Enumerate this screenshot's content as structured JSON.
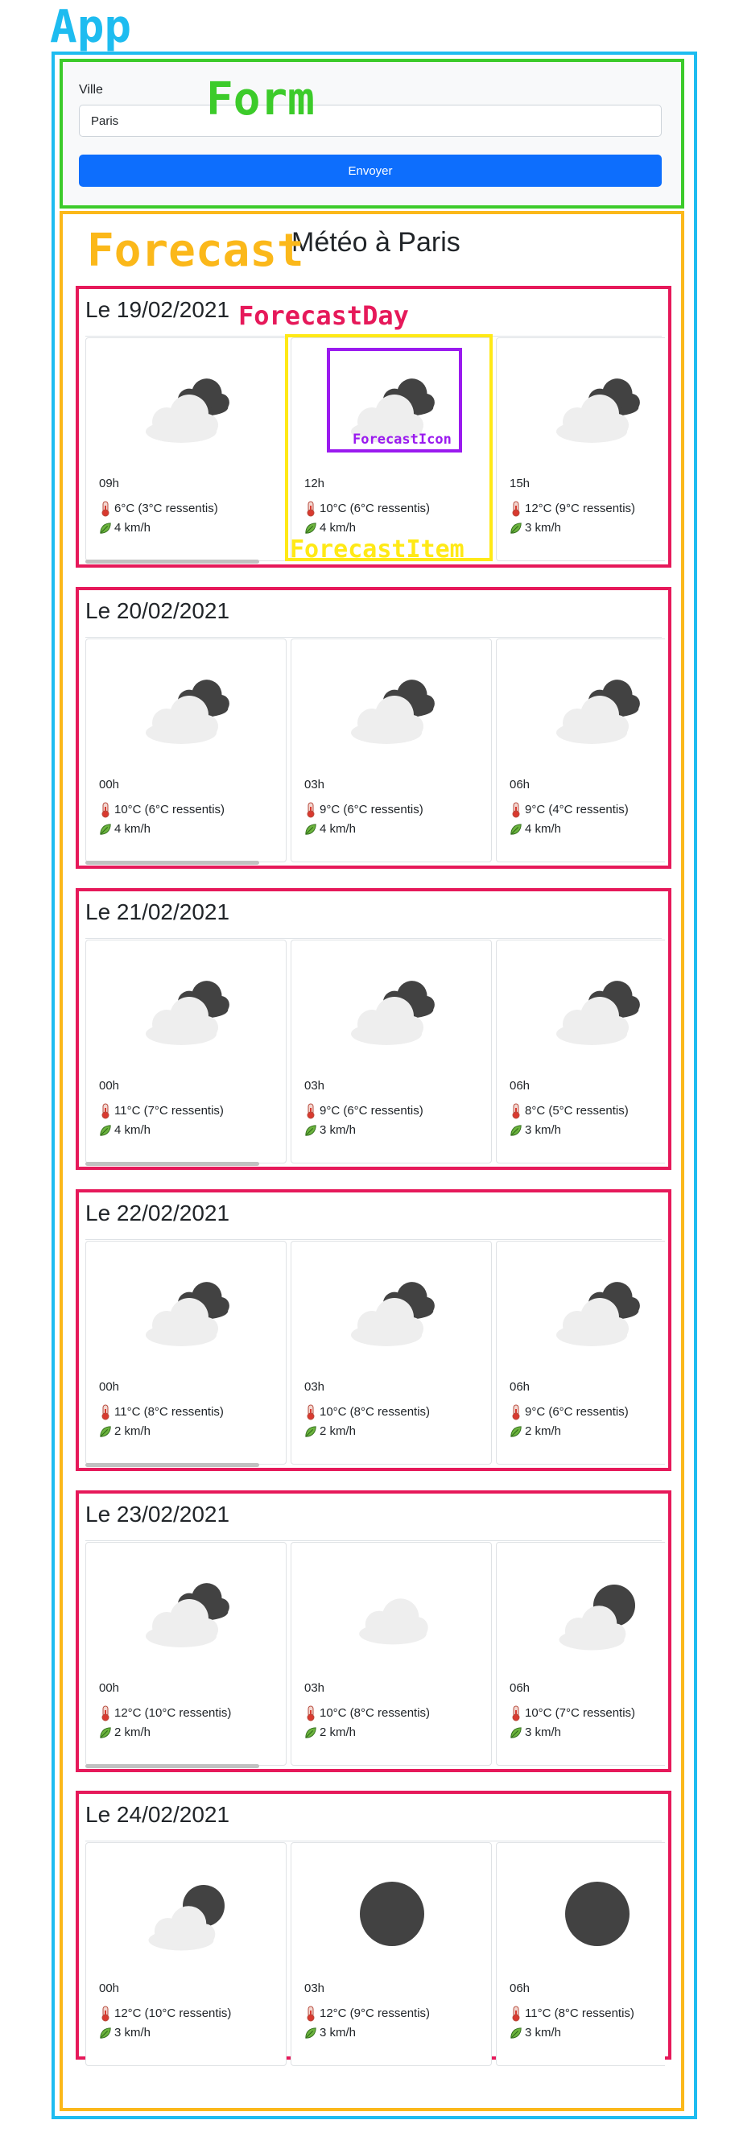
{
  "annotations": {
    "app": "App",
    "form": "Form",
    "forecast": "Forecast",
    "forecast_day": "ForecastDay",
    "forecast_item": "ForecastItem",
    "forecast_icon": "ForecastIcon"
  },
  "form": {
    "label": "Ville",
    "value": "Paris",
    "submit_label": "Envoyer"
  },
  "forecast": {
    "title": "Météo à Paris",
    "days": [
      {
        "title": "Le 19/02/2021",
        "items": [
          {
            "hour": "09h",
            "temp": "6°C (3°C ressentis)",
            "wind": "4 km/h",
            "icon": "cloud-dark-cloud"
          },
          {
            "hour": "12h",
            "temp": "10°C (6°C ressentis)",
            "wind": "4 km/h",
            "icon": "cloud-dark-cloud"
          },
          {
            "hour": "15h",
            "temp": "12°C (9°C ressentis)",
            "wind": "3 km/h",
            "icon": "cloud-dark-cloud"
          }
        ]
      },
      {
        "title": "Le 20/02/2021",
        "items": [
          {
            "hour": "00h",
            "temp": "10°C (6°C ressentis)",
            "wind": "4 km/h",
            "icon": "cloud-dark-cloud"
          },
          {
            "hour": "03h",
            "temp": "9°C (6°C ressentis)",
            "wind": "4 km/h",
            "icon": "cloud-dark-cloud"
          },
          {
            "hour": "06h",
            "temp": "9°C (4°C ressentis)",
            "wind": "4 km/h",
            "icon": "cloud-dark-cloud"
          }
        ]
      },
      {
        "title": "Le 21/02/2021",
        "items": [
          {
            "hour": "00h",
            "temp": "11°C (7°C ressentis)",
            "wind": "4 km/h",
            "icon": "cloud-dark-cloud"
          },
          {
            "hour": "03h",
            "temp": "9°C (6°C ressentis)",
            "wind": "3 km/h",
            "icon": "cloud-dark-cloud"
          },
          {
            "hour": "06h",
            "temp": "8°C (5°C ressentis)",
            "wind": "3 km/h",
            "icon": "cloud-dark-cloud"
          }
        ]
      },
      {
        "title": "Le 22/02/2021",
        "items": [
          {
            "hour": "00h",
            "temp": "11°C (8°C ressentis)",
            "wind": "2 km/h",
            "icon": "cloud-dark-cloud"
          },
          {
            "hour": "03h",
            "temp": "10°C (8°C ressentis)",
            "wind": "2 km/h",
            "icon": "cloud-dark-cloud"
          },
          {
            "hour": "06h",
            "temp": "9°C (6°C ressentis)",
            "wind": "2 km/h",
            "icon": "cloud-dark-cloud"
          }
        ]
      },
      {
        "title": "Le 23/02/2021",
        "items": [
          {
            "hour": "00h",
            "temp": "12°C (10°C ressentis)",
            "wind": "2 km/h",
            "icon": "cloud-dark-cloud"
          },
          {
            "hour": "03h",
            "temp": "10°C (8°C ressentis)",
            "wind": "2 km/h",
            "icon": "light-cloud"
          },
          {
            "hour": "06h",
            "temp": "10°C (7°C ressentis)",
            "wind": "3 km/h",
            "icon": "cloud-dark-moon"
          }
        ]
      },
      {
        "title": "Le 24/02/2021",
        "items": [
          {
            "hour": "00h",
            "temp": "12°C (10°C ressentis)",
            "wind": "3 km/h",
            "icon": "cloud-dark-moon"
          },
          {
            "hour": "03h",
            "temp": "12°C (9°C ressentis)",
            "wind": "3 km/h",
            "icon": "dark-moon"
          },
          {
            "hour": "06h",
            "temp": "11°C (8°C ressentis)",
            "wind": "3 km/h",
            "icon": "dark-moon"
          }
        ]
      }
    ]
  },
  "colors": {
    "app": "#1ebcf0",
    "form": "#3ccb2a",
    "forecast": "#fbb81a",
    "forecast_day": "#e6195a",
    "forecast_item": "#ffe916",
    "forecast_icon": "#9a1aef",
    "button": "#0d6efd"
  }
}
